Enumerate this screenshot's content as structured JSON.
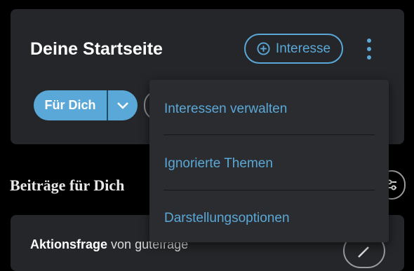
{
  "header": {
    "title": "Deine Startseite",
    "interest_button": "Interesse"
  },
  "filter": {
    "selected": "Für Dich"
  },
  "section": {
    "title": "Beiträge für Dich"
  },
  "post": {
    "type": "Aktionsfrage",
    "by_word": "von",
    "author": "gutefrage"
  },
  "menu": {
    "items": [
      {
        "label": "Interessen verwalten"
      },
      {
        "label": "Ignorierte Themen"
      },
      {
        "label": "Darstellungsoptionen"
      }
    ]
  },
  "colors": {
    "accent": "#5aa8d7",
    "card": "#252629",
    "menu": "#2b2c2f",
    "background": "#000000"
  },
  "icons": {
    "interest": "plus-circle-icon",
    "more": "more-vertical-icon",
    "dropdown": "chevron-down-icon",
    "filter": "tune-icon",
    "edit": "pencil-icon"
  }
}
